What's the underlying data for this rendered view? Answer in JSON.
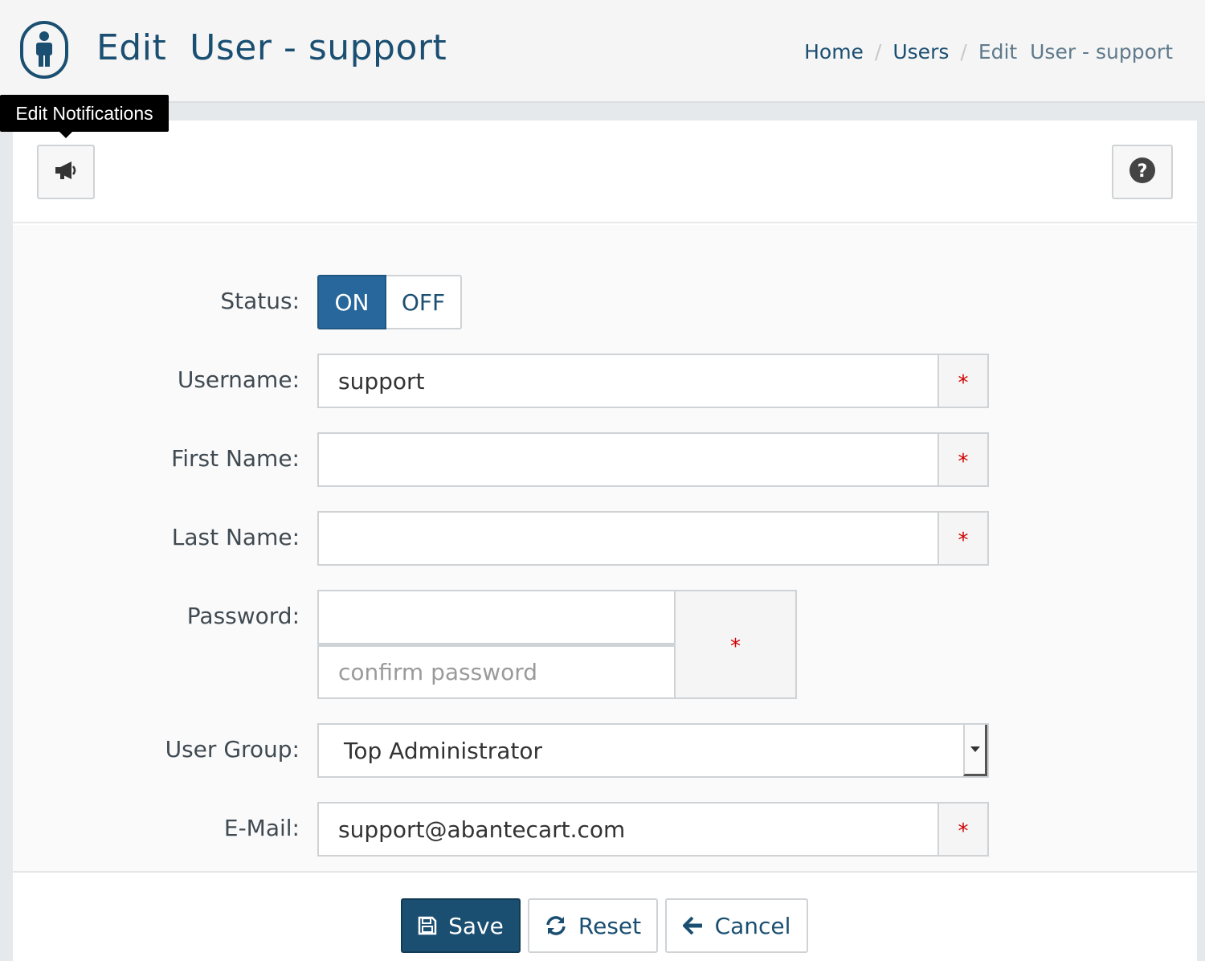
{
  "header": {
    "title": "Edit  User - support",
    "breadcrumb": {
      "home": "Home",
      "users": "Users",
      "current": "Edit  User - support",
      "separator": "/"
    }
  },
  "tooltip": {
    "text": "Edit Notifications"
  },
  "toolbar": {
    "notifications_icon": "bullhorn-icon",
    "help_icon": "question-circle-icon"
  },
  "form": {
    "status": {
      "label": "Status:",
      "on": "ON",
      "off": "OFF",
      "value": "ON"
    },
    "username": {
      "label": "Username:",
      "value": "support",
      "required_mark": "*"
    },
    "first_name": {
      "label": "First Name:",
      "value": "",
      "required_mark": "*"
    },
    "last_name": {
      "label": "Last Name:",
      "value": "",
      "required_mark": "*"
    },
    "password": {
      "label": "Password:",
      "value": "",
      "confirm_placeholder": "confirm password",
      "required_mark": "*"
    },
    "user_group": {
      "label": "User Group:",
      "value": "Top Administrator"
    },
    "email": {
      "label": "E-Mail:",
      "value": "support@abantecart.com",
      "required_mark": "*"
    }
  },
  "actions": {
    "save": "Save",
    "reset": "Reset",
    "cancel": "Cancel"
  },
  "colors": {
    "primary": "#1b4f72",
    "toggle_on": "#27679b",
    "required": "#d00000"
  }
}
